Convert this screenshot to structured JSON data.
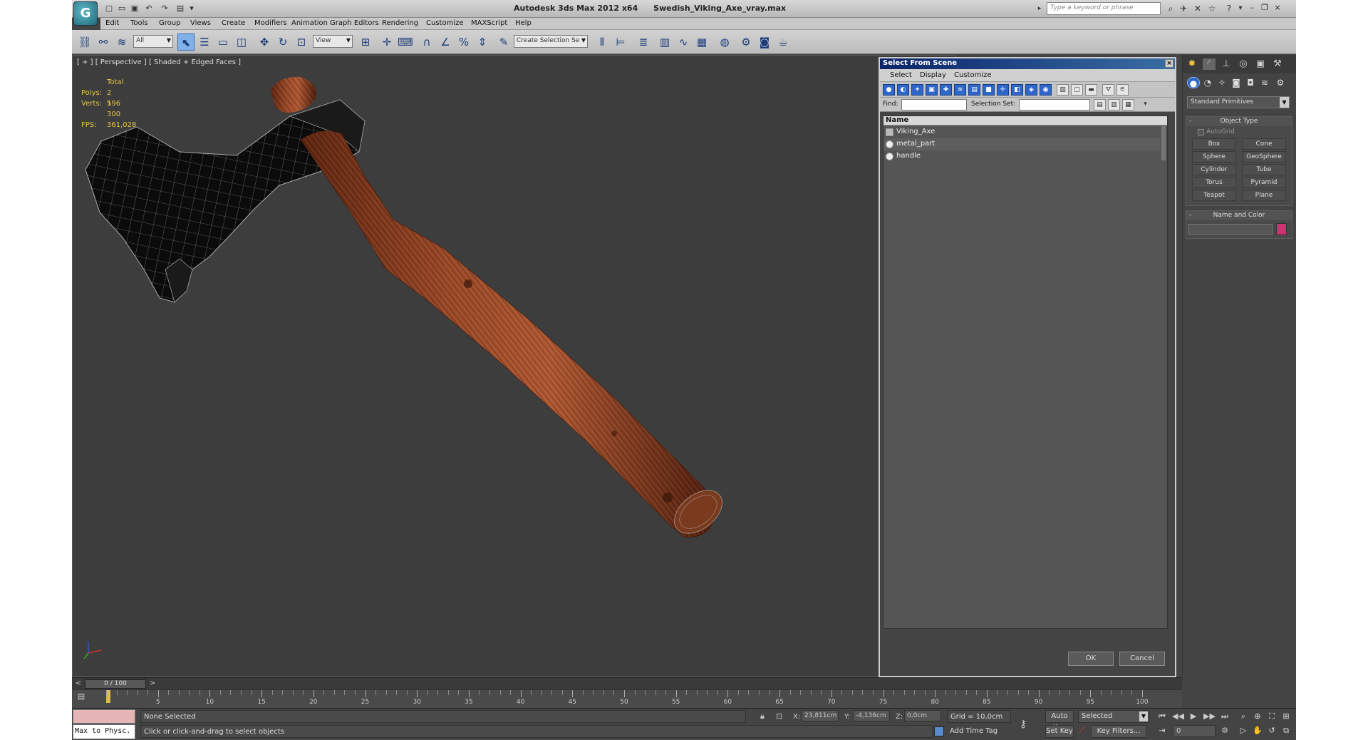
{
  "window": {
    "title_app": "Autodesk 3ds Max  2012 x64",
    "title_file": "Swedish_Viking_Axe_vray.max",
    "search_placeholder": "Type a keyword or phrase",
    "logo_glyph": "G"
  },
  "menu": [
    "Edit",
    "Tools",
    "Group",
    "Views",
    "Create",
    "Modifiers",
    "Animation",
    "Graph Editors",
    "Rendering",
    "Customize",
    "MAXScript",
    "Help"
  ],
  "toolbar": {
    "filter_value": "All",
    "refcoord_value": "View",
    "selection_set_value": "Create Selection Se"
  },
  "viewport": {
    "label": "[ + ] [ Perspective ] [ Shaded + Edged Faces ]",
    "stats_header": "Total",
    "stats": [
      {
        "key": "Polys:",
        "value": "2 596"
      },
      {
        "key": "Verts:",
        "value": "1 300"
      }
    ],
    "fps_key": "FPS:",
    "fps_value": "361,028",
    "colors": {
      "background": "#3d3d3d",
      "wood": "#8a3e20",
      "metal": "#111111",
      "wire": "#9a9a9a"
    }
  },
  "dialog": {
    "title": "Select From Scene",
    "close_glyph": "×",
    "menu": [
      "Select",
      "Display",
      "Customize"
    ],
    "find_label": "Find:",
    "selection_set_label": "Selection Set:",
    "column_name": "Name",
    "objects": [
      {
        "name": "Viking_Axe",
        "kind": "group"
      },
      {
        "name": "metal_part",
        "kind": "object"
      },
      {
        "name": "handle",
        "kind": "object"
      }
    ],
    "ok_label": "OK",
    "cancel_label": "Cancel"
  },
  "command_panel": {
    "primitives_dropdown": "Standard Primitives",
    "object_type_title": "Object Type",
    "autogrid_label": "AutoGrid",
    "buttons": [
      "Box",
      "Cone",
      "Sphere",
      "GeoSphere",
      "Cylinder",
      "Tube",
      "Torus",
      "Pyramid",
      "Teapot",
      "Plane"
    ],
    "name_color_title": "Name and Color",
    "swatch_color": "#d2306e",
    "collapse_glyph": "-"
  },
  "timeline": {
    "slider_label": "0 / 100",
    "prev_glyph": "<",
    "next_glyph": ">",
    "ticks": [
      "5",
      "10",
      "15",
      "20",
      "25",
      "30",
      "35",
      "40",
      "45",
      "50",
      "55",
      "60",
      "65",
      "70",
      "75",
      "80",
      "85",
      "90",
      "95",
      "100"
    ]
  },
  "status": {
    "maxscript_text": "Max to Physc.",
    "selection_text": "None Selected",
    "prompt_text": "Click or click-and-drag to select objects",
    "x_label": "X:",
    "x_value": "23,811cm",
    "y_label": "Y:",
    "y_value": "-4,136cm",
    "z_label": "Z:",
    "z_value": "0,0cm",
    "grid_text": "Grid = 10,0cm",
    "add_time_tag": "Add Time Tag",
    "auto_key": "Auto Key",
    "set_key": "Set Key",
    "selected_value": "Selected",
    "key_filters": "Key Filters...",
    "frame_value": "0"
  }
}
